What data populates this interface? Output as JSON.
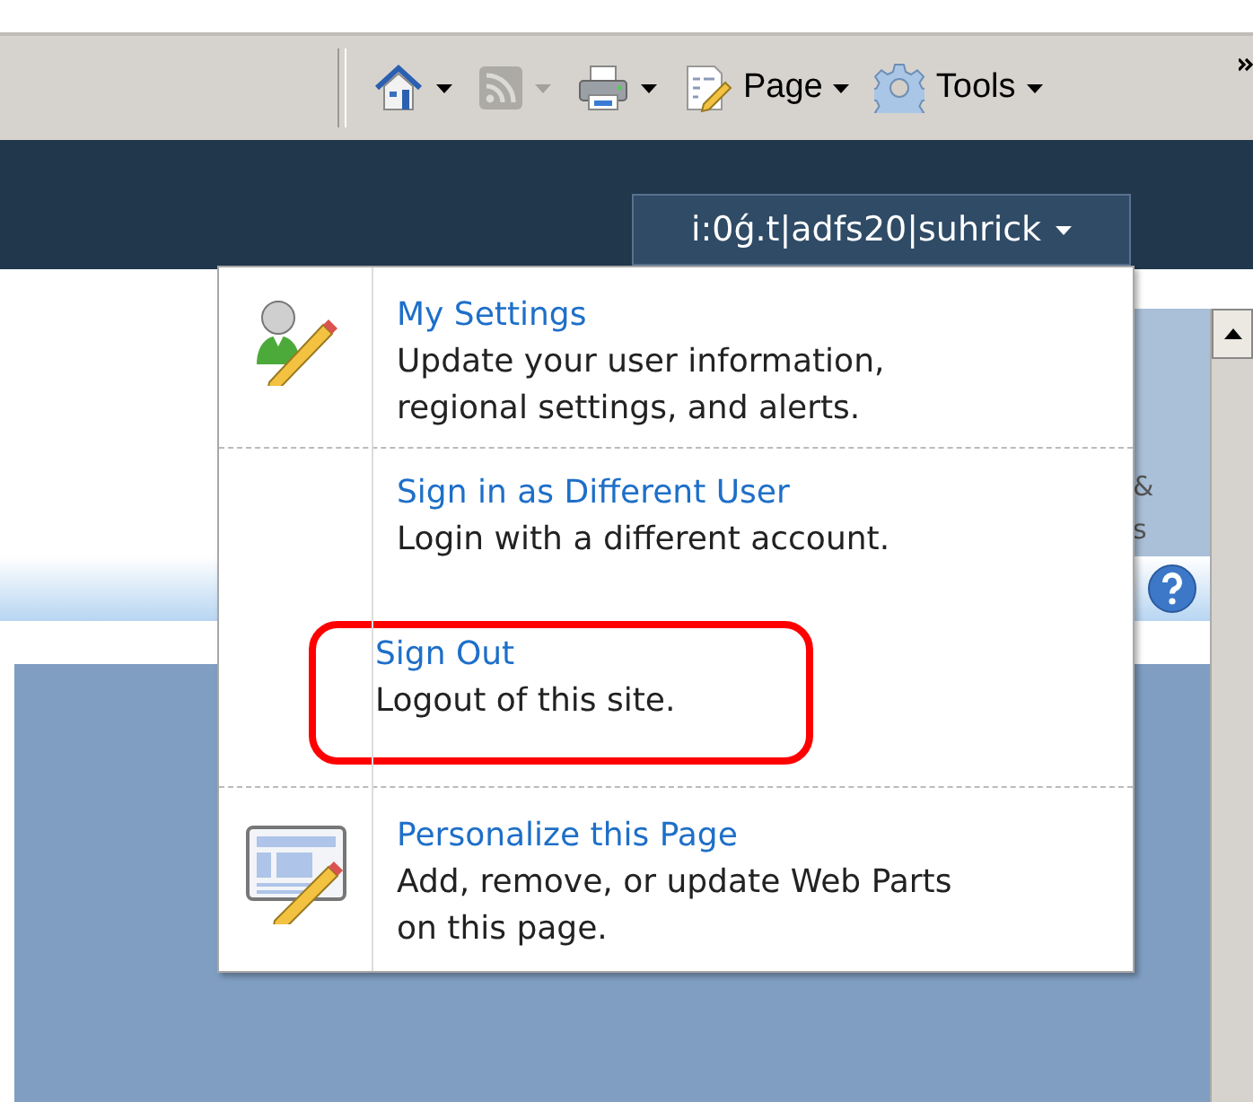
{
  "toolbar": {
    "buttons": [
      {
        "kind": "home",
        "disabled": false
      },
      {
        "kind": "feeds",
        "disabled": true
      },
      {
        "kind": "print",
        "disabled": false
      },
      {
        "kind": "page",
        "label": "Page",
        "disabled": false
      },
      {
        "kind": "tools",
        "label": "Tools",
        "disabled": false
      }
    ]
  },
  "user_button": {
    "label": "i:0ǵ.t|adfs20|suhrick"
  },
  "partial_labels": [
    "&",
    "s"
  ],
  "menu": {
    "items": [
      {
        "kind": "person",
        "title": "My Settings",
        "description": "Update your user information, regional settings, and alerts.",
        "highlighted": false
      },
      {
        "kind": "plain",
        "title": "Sign in as Different User",
        "description": "Login with a different account.",
        "highlighted": false
      },
      {
        "kind": "plain",
        "title": "Sign Out",
        "description": "Logout of this site.",
        "highlighted": true
      },
      {
        "kind": "page",
        "title": "Personalize this Page",
        "description": "Add, remove, or update Web Parts on this page.",
        "highlighted": false
      }
    ]
  }
}
